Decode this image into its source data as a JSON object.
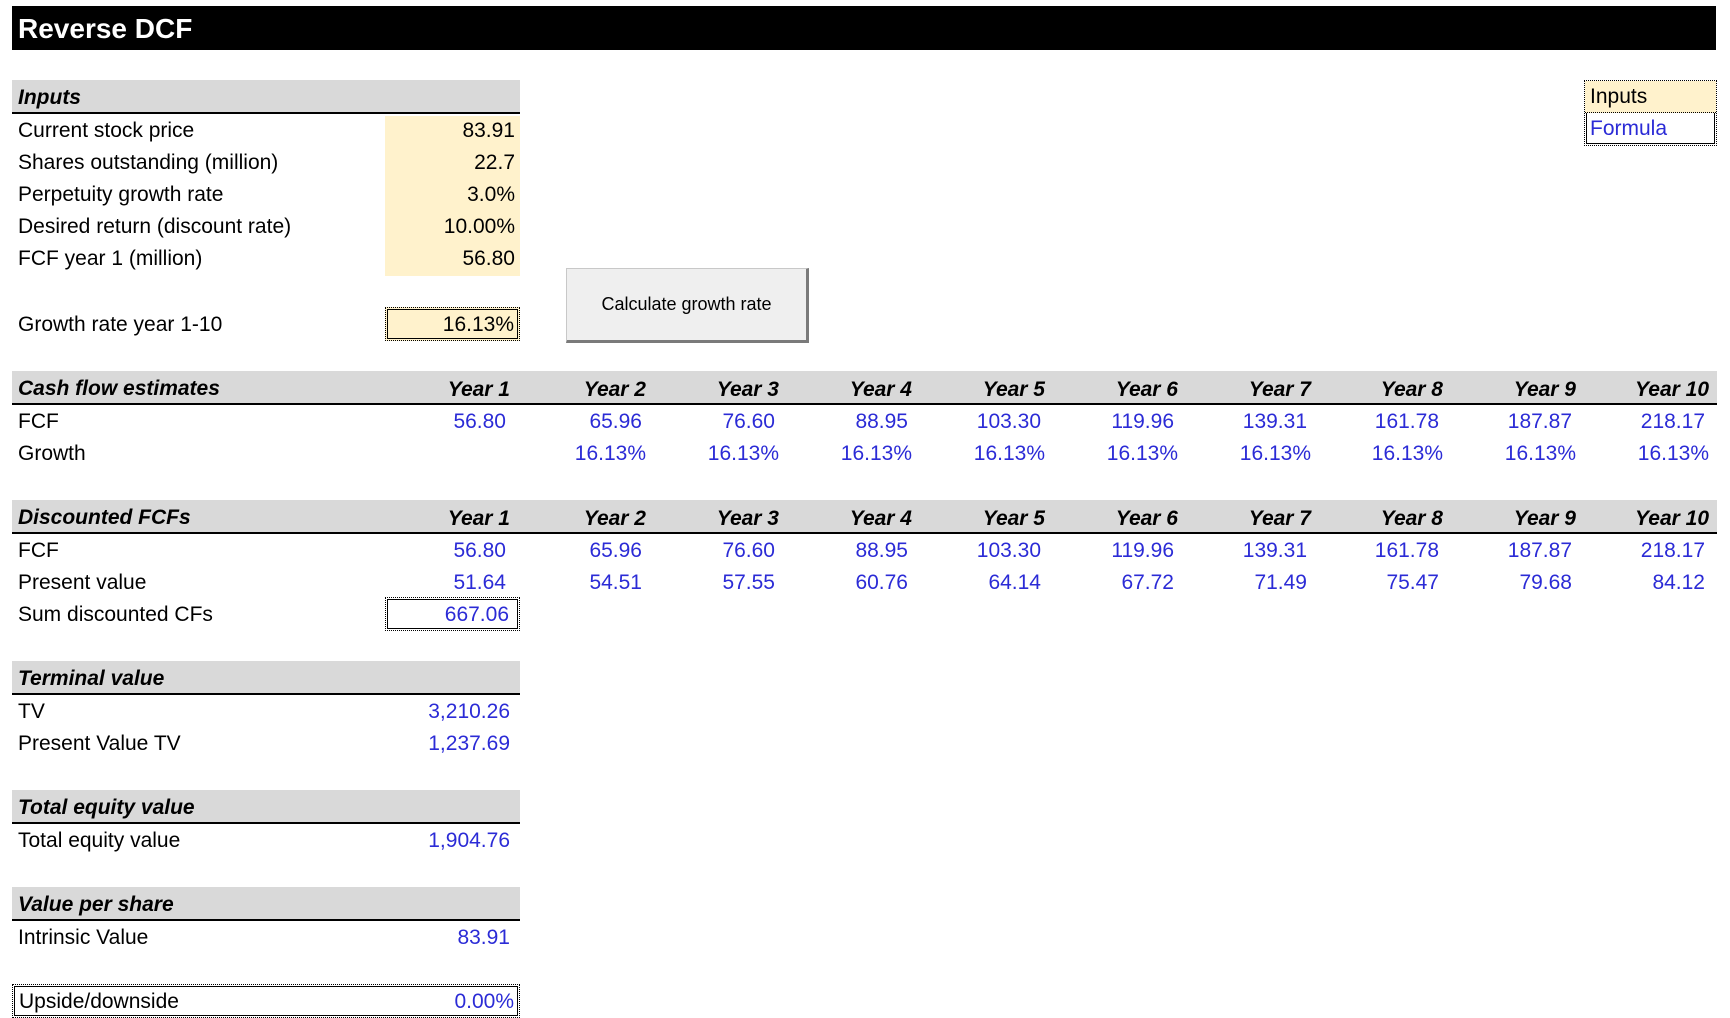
{
  "title": "Reverse DCF",
  "legend": {
    "inputs": "Inputs",
    "formula": "Formula"
  },
  "inputs": {
    "header": "Inputs",
    "rows": [
      {
        "label": "Current stock price",
        "value": "83.91"
      },
      {
        "label": "Shares outstanding (million)",
        "value": "22.7"
      },
      {
        "label": "Perpetuity growth rate",
        "value": "3.0%"
      },
      {
        "label": "Desired return (discount rate)",
        "value": "10.00%"
      },
      {
        "label": "FCF year 1 (million)",
        "value": "56.80"
      }
    ],
    "growth_label": "Growth rate year 1-10",
    "growth_value": "16.13%"
  },
  "button_label": "Calculate growth rate",
  "years": [
    "Year 1",
    "Year 2",
    "Year 3",
    "Year 4",
    "Year 5",
    "Year 6",
    "Year 7",
    "Year 8",
    "Year 9",
    "Year 10"
  ],
  "cashflow": {
    "header": "Cash flow estimates",
    "fcf_label": "FCF",
    "fcf": [
      "56.80",
      "65.96",
      "76.60",
      "88.95",
      "103.30",
      "119.96",
      "139.31",
      "161.78",
      "187.87",
      "218.17"
    ],
    "growth_label": "Growth",
    "growth": [
      "",
      "16.13%",
      "16.13%",
      "16.13%",
      "16.13%",
      "16.13%",
      "16.13%",
      "16.13%",
      "16.13%",
      "16.13%"
    ]
  },
  "discounted": {
    "header": "Discounted FCFs",
    "fcf_label": "FCF",
    "fcf": [
      "56.80",
      "65.96",
      "76.60",
      "88.95",
      "103.30",
      "119.96",
      "139.31",
      "161.78",
      "187.87",
      "218.17"
    ],
    "pv_label": "Present value",
    "pv": [
      "51.64",
      "54.51",
      "57.55",
      "60.76",
      "64.14",
      "67.72",
      "71.49",
      "75.47",
      "79.68",
      "84.12"
    ],
    "sum_label": "Sum discounted CFs",
    "sum_value": "667.06"
  },
  "terminal": {
    "header": "Terminal value",
    "tv_label": "TV",
    "tv_value": "3,210.26",
    "pvtv_label": "Present Value TV",
    "pvtv_value": "1,237.69"
  },
  "equity": {
    "header": "Total equity value",
    "label": "Total equity value",
    "value": "1,904.76"
  },
  "per_share": {
    "header": "Value per share",
    "label": "Intrinsic Value",
    "value": "83.91"
  },
  "upside": {
    "label": "Upside/downside",
    "value": "0.00%"
  }
}
